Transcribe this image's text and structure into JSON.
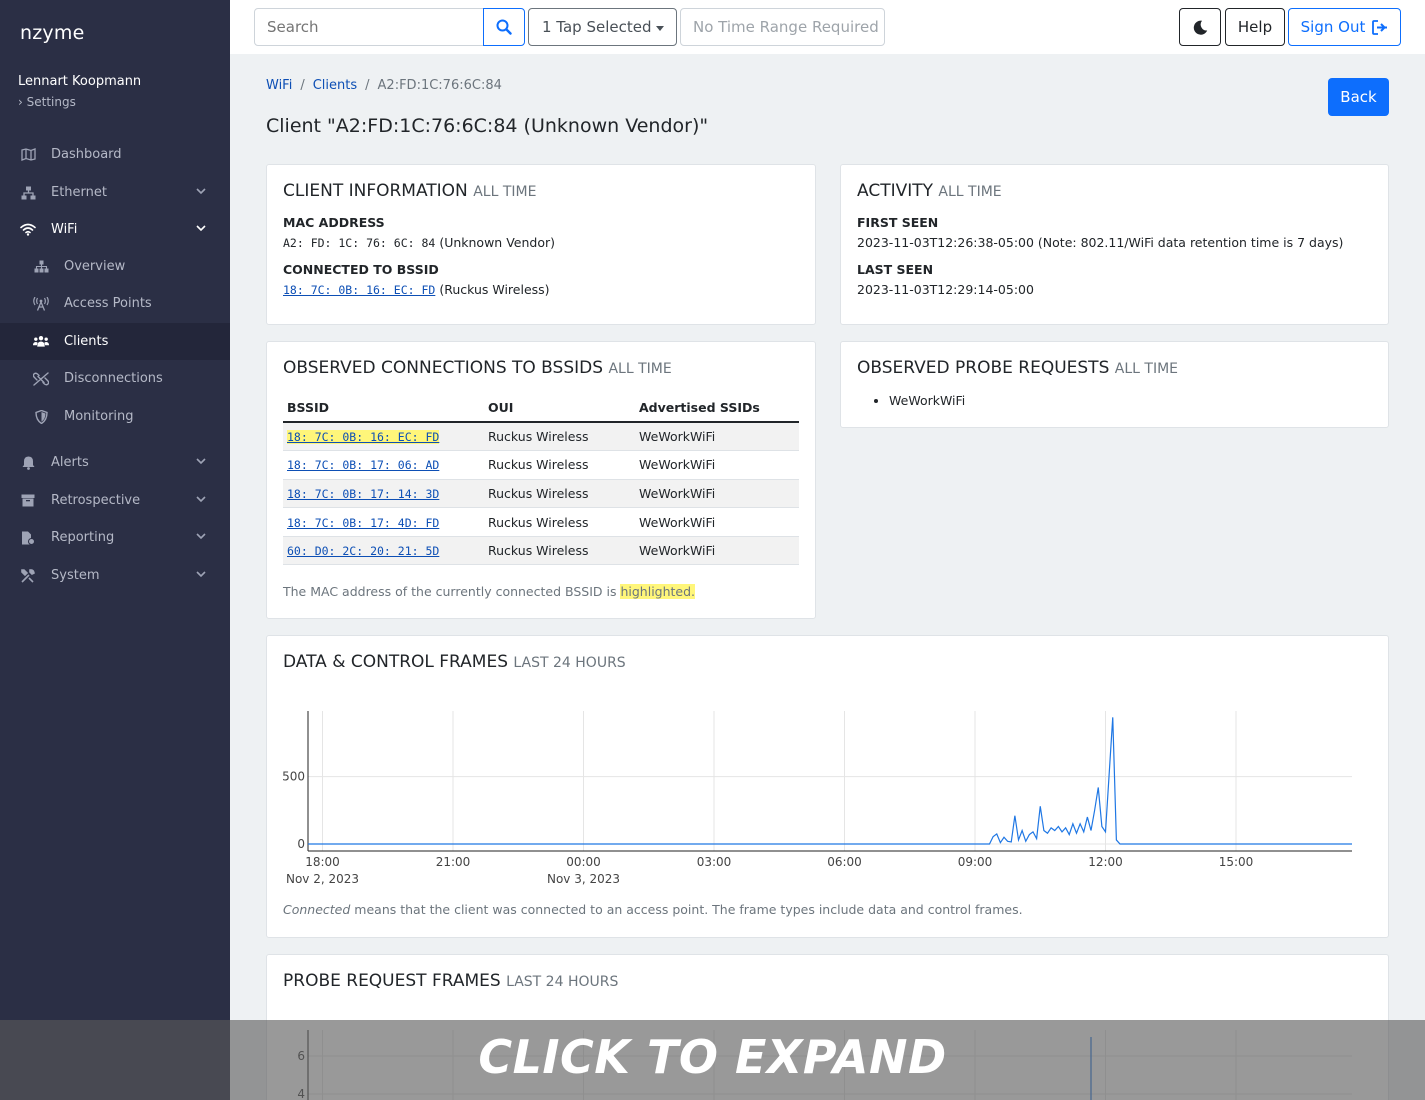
{
  "app": {
    "brand": "nzyme",
    "user_name": "Lennart Koopmann",
    "settings_label": "Settings"
  },
  "sidebar": {
    "items": [
      {
        "label": "Dashboard",
        "icon": "map-icon"
      },
      {
        "label": "Ethernet",
        "icon": "network-icon"
      },
      {
        "label": "WiFi",
        "icon": "wifi-icon"
      },
      {
        "label": "Overview",
        "icon": "sitemap-icon"
      },
      {
        "label": "Access Points",
        "icon": "tower-icon"
      },
      {
        "label": "Clients",
        "icon": "users-icon"
      },
      {
        "label": "Disconnections",
        "icon": "unlink-icon"
      },
      {
        "label": "Monitoring",
        "icon": "shield-icon"
      },
      {
        "label": "Alerts",
        "icon": "bell-icon"
      },
      {
        "label": "Retrospective",
        "icon": "archive-icon"
      },
      {
        "label": "Reporting",
        "icon": "file-chart-icon"
      },
      {
        "label": "System",
        "icon": "tools-icon"
      }
    ]
  },
  "topbar": {
    "search_placeholder": "Search",
    "tap_selected": "1 Tap Selected",
    "time_range": "No Time Range Required",
    "help": "Help",
    "sign_out": "Sign Out"
  },
  "breadcrumb": {
    "wifi": "WiFi",
    "clients": "Clients",
    "current": "A2:FD:1C:76:6C:84"
  },
  "page": {
    "title": "Client \"A2:FD:1C:76:6C:84 (Unknown Vendor)\"",
    "back": "Back"
  },
  "client_info": {
    "title": "CLIENT INFORMATION",
    "range": "ALL TIME",
    "mac_label": "MAC ADDRESS",
    "mac": "A2: FD: 1C: 76: 6C: 84",
    "mac_vendor": "(Unknown Vendor)",
    "bssid_label": "CONNECTED TO BSSID",
    "bssid": "18: 7C: 0B: 16: EC: FD",
    "bssid_vendor": "(Ruckus Wireless)"
  },
  "activity": {
    "title": "ACTIVITY",
    "range": "ALL TIME",
    "first_label": "FIRST SEEN",
    "first": "2023-11-03T12:26:38-05:00 (Note: 802.11/WiFi data retention time is 7 days)",
    "last_label": "LAST SEEN",
    "last": "2023-11-03T12:29:14-05:00"
  },
  "connections": {
    "title": "OBSERVED CONNECTIONS TO BSSIDS",
    "range": "ALL TIME",
    "headers": [
      "BSSID",
      "OUI",
      "Advertised SSIDs"
    ],
    "rows": [
      [
        "18: 7C: 0B: 16: EC: FD",
        "Ruckus Wireless",
        "WeWorkWiFi"
      ],
      [
        "18: 7C: 0B: 17: 06: AD",
        "Ruckus Wireless",
        "WeWorkWiFi"
      ],
      [
        "18: 7C: 0B: 17: 14: 3D",
        "Ruckus Wireless",
        "WeWorkWiFi"
      ],
      [
        "18: 7C: 0B: 17: 4D: FD",
        "Ruckus Wireless",
        "WeWorkWiFi"
      ],
      [
        "60: D0: 2C: 20: 21: 5D",
        "Ruckus Wireless",
        "WeWorkWiFi"
      ]
    ],
    "note_prefix": "The MAC address of the currently connected BSSID is ",
    "note_highlight": "highlighted."
  },
  "probe_requests": {
    "title": "OBSERVED PROBE REQUESTS",
    "range": "ALL TIME",
    "items": [
      "WeWorkWiFi"
    ]
  },
  "data_frames": {
    "title": "DATA & CONTROL FRAMES",
    "range": "LAST 24 HOURS",
    "note_em": "Connected",
    "note_rest": " means that the client was connected to an access point. The frame types include data and control frames."
  },
  "probe_frames": {
    "title": "PROBE REQUEST FRAMES",
    "range": "LAST 24 HOURS"
  },
  "overlay": {
    "text": "CLICK TO EXPAND"
  },
  "colors": {
    "accent": "#0d6efd",
    "line": "#1f77e4",
    "highlight": "#fff67a",
    "sidebar": "#2b2f45"
  },
  "chart_data": [
    {
      "type": "line",
      "title": "DATA & CONTROL FRAMES",
      "x_ticks": [
        "18:00",
        "21:00",
        "00:00",
        "03:00",
        "06:00",
        "09:00",
        "12:00",
        "15:00"
      ],
      "x_tick_dates": [
        "Nov 2, 2023",
        "",
        "Nov 3, 2023",
        "",
        "",
        "",
        "",
        ""
      ],
      "y_ticks": [
        0,
        500
      ],
      "ylim": [
        0,
        950
      ],
      "xlim": [
        "2023-11-02T17:40",
        "2023-11-03T17:40"
      ],
      "series": [
        {
          "x": [
            "09:20",
            "09:25",
            "09:30",
            "09:35",
            "09:40",
            "09:45",
            "09:50",
            "09:55",
            "10:00",
            "10:05",
            "10:10",
            "10:15",
            "10:20",
            "10:25",
            "10:30",
            "10:35",
            "10:40",
            "10:45",
            "10:50",
            "10:55",
            "11:00",
            "11:05",
            "11:10",
            "11:15",
            "11:20",
            "11:25",
            "11:30",
            "11:35",
            "11:40",
            "11:45",
            "11:50",
            "11:55",
            "12:00",
            "12:10",
            "12:15",
            "12:20"
          ],
          "y": [
            0,
            55,
            75,
            10,
            50,
            20,
            15,
            210,
            30,
            100,
            20,
            70,
            90,
            40,
            280,
            100,
            80,
            120,
            100,
            130,
            90,
            120,
            70,
            150,
            80,
            150,
            90,
            200,
            100,
            250,
            420,
            130,
            90,
            940,
            30,
            0
          ]
        }
      ]
    },
    {
      "type": "line",
      "title": "PROBE REQUEST FRAMES",
      "y_ticks": [
        4,
        6
      ],
      "series": [
        {
          "x": [
            "11:40"
          ],
          "y": [
            7
          ]
        }
      ]
    }
  ]
}
